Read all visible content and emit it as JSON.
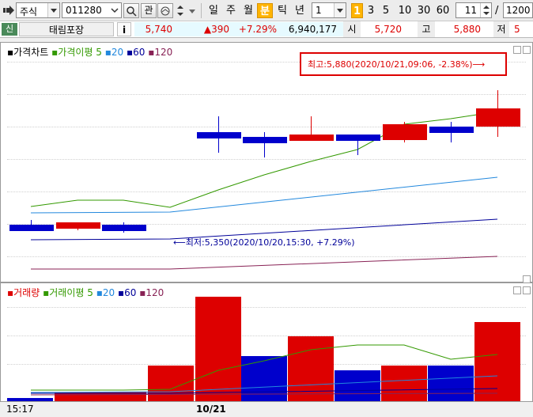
{
  "toolbar": {
    "market": "주식",
    "code": "011280",
    "btn_gwan": "관",
    "periods": [
      "일",
      "주",
      "월",
      "분",
      "틱",
      "년"
    ],
    "active_period": "분",
    "interval_value": "1",
    "minutes": [
      "1",
      "3",
      "5",
      "10",
      "30",
      "60"
    ],
    "active_minute": "1",
    "count_value": "11",
    "total_separator": "/",
    "total_value": "1200"
  },
  "info": {
    "badge": "신",
    "name": "태림포장",
    "info_btn": "i",
    "price": "5,740",
    "change": "▲390",
    "change_pct": "+7.29%",
    "volume": "6,940,177",
    "open_label": "시",
    "open_value": "5,720",
    "high_label": "고",
    "high_value": "5,880",
    "low_label": "저",
    "low_value": "5"
  },
  "price_pane": {
    "legend_title": "가격차트",
    "ma_title": "가격이평",
    "ma_periods": [
      "5",
      "20",
      "60",
      "120"
    ],
    "high_annotation": "최고:5,880(2020/10/21,09:06, -2.38%)⟶",
    "low_annotation": "⟵최저:5,350(2020/10/20,15:30, +7.29%)"
  },
  "volume_pane": {
    "legend_title": "거래량",
    "ma_title": "거래이평",
    "ma_periods": [
      "5",
      "20",
      "60",
      "120"
    ]
  },
  "x_axis": {
    "left_label": "15:17",
    "date_label": "10/21"
  },
  "colors": {
    "up": "#dd0000",
    "down": "#0000cc",
    "ma5": "#339900",
    "ma20": "#2288dd",
    "ma60": "#000099",
    "ma120": "#882255"
  },
  "chart_data": {
    "type": "candlestick",
    "ohlc": [
      {
        "o": 5360,
        "h": 5380,
        "l": 5340,
        "c": 5350
      },
      {
        "o": 5350,
        "h": 5370,
        "l": 5340,
        "c": 5370
      },
      {
        "o": 5360,
        "h": 5370,
        "l": 5330,
        "c": 5340
      },
      {
        "o": 5720,
        "h": 5780,
        "l": 5640,
        "c": 5700
      },
      {
        "o": 5700,
        "h": 5720,
        "l": 5620,
        "c": 5690
      },
      {
        "o": 5690,
        "h": 5780,
        "l": 5690,
        "c": 5710
      },
      {
        "o": 5710,
        "h": 5710,
        "l": 5630,
        "c": 5690
      },
      {
        "o": 5690,
        "h": 5760,
        "l": 5680,
        "c": 5750
      },
      {
        "o": 5740,
        "h": 5760,
        "l": 5680,
        "c": 5730
      },
      {
        "o": 5740,
        "h": 5880,
        "l": 5700,
        "c": 5810
      }
    ],
    "volume": [
      3,
      9,
      10,
      38,
      112,
      48,
      70,
      33,
      38,
      38,
      85
    ],
    "volume_up": [
      false,
      true,
      true,
      true,
      true,
      false,
      true,
      false,
      true,
      false,
      true
    ]
  }
}
